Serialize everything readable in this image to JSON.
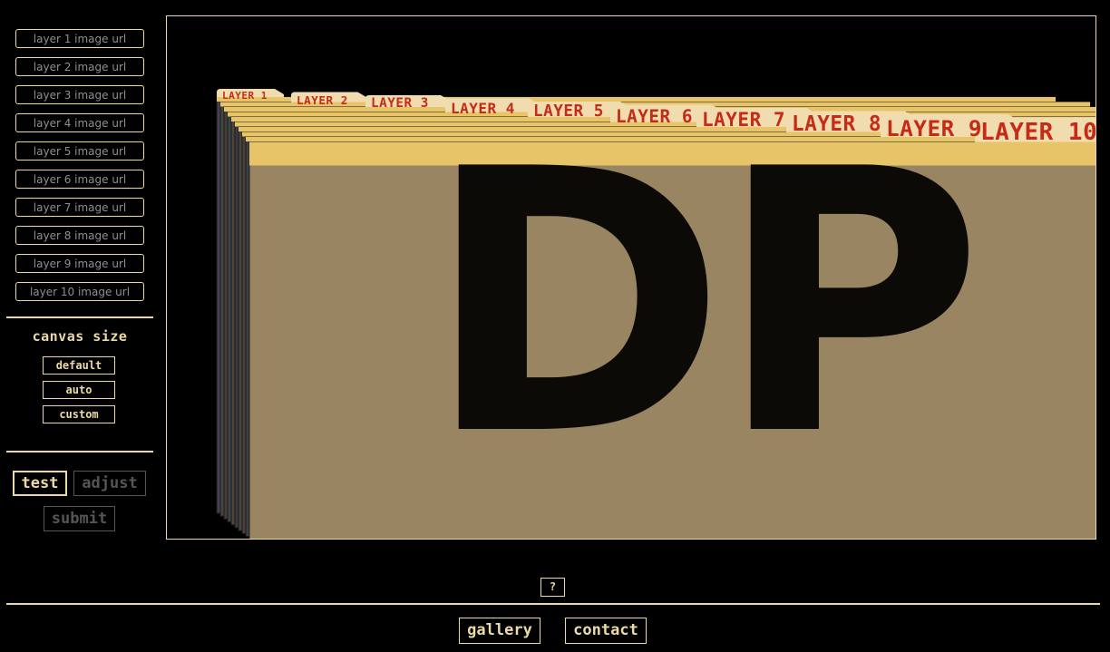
{
  "sidebar": {
    "layer_inputs": [
      {
        "placeholder": "layer 1 image url"
      },
      {
        "placeholder": "layer 2 image url"
      },
      {
        "placeholder": "layer 3 image url"
      },
      {
        "placeholder": "layer 4 image url"
      },
      {
        "placeholder": "layer 5 image url"
      },
      {
        "placeholder": "layer 6 image url"
      },
      {
        "placeholder": "layer 7 image url"
      },
      {
        "placeholder": "layer 8 image url"
      },
      {
        "placeholder": "layer 9 image url"
      },
      {
        "placeholder": "layer 10 image url"
      }
    ],
    "canvas_size": {
      "title": "canvas size",
      "options": [
        "default",
        "auto",
        "custom"
      ],
      "selected": "default"
    },
    "modes": {
      "test_label": "test",
      "adjust_label": "adjust",
      "submit_label": "submit",
      "active": "test"
    }
  },
  "canvas": {
    "tabs": [
      "LAYER 1",
      "LAYER 2",
      "LAYER 3",
      "LAYER 4",
      "LAYER 5",
      "LAYER 6",
      "LAYER 7",
      "LAYER 8",
      "LAYER 9",
      "LAYER 10"
    ],
    "artwork_text": "DP",
    "folder_color": "#e8c468",
    "tab_color": "#f0dcae",
    "tab_text_color": "#c52b17",
    "content_color": "#9a8562"
  },
  "footer": {
    "help_label": "?",
    "gallery_label": "gallery",
    "contact_label": "contact"
  },
  "colors": {
    "accent": "#ebd9a6",
    "background": "#000000",
    "disabled": "#555555"
  }
}
